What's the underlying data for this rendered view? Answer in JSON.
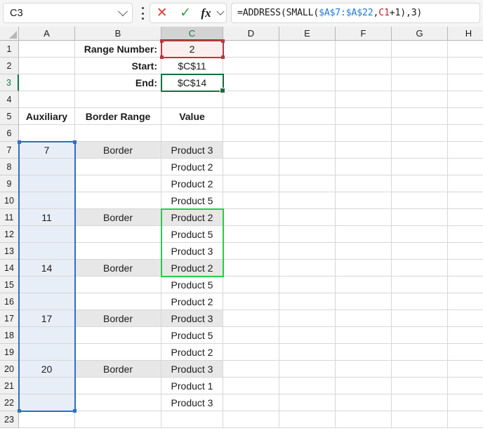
{
  "formula_bar": {
    "name_box_value": "C3",
    "name_box_chevron_icon": "chevron-down-icon",
    "options_icon": "kebab-menu-icon",
    "cancel_icon": "cancel-x-icon",
    "cancel_glyph": "✕",
    "enter_icon": "confirm-check-icon",
    "enter_glyph": "✓",
    "fx_label": "fx",
    "fx_chevron_icon": "chevron-down-icon",
    "formula_parts": [
      {
        "text": "=ADDRESS(SMALL(",
        "color": "black"
      },
      {
        "text": "$A$7:$A$22",
        "color": "blue"
      },
      {
        "text": ",",
        "color": "black"
      },
      {
        "text": "C1",
        "color": "red"
      },
      {
        "text": "+1),3)",
        "color": "black"
      }
    ],
    "formula_full": "=ADDRESS(SMALL($A$7:$A$22,C1+1),3)"
  },
  "grid": {
    "select_all_icon": "select-all-triangle-icon",
    "column_headers": [
      "A",
      "B",
      "C",
      "D",
      "E",
      "F",
      "G",
      "H"
    ],
    "active_column": "C",
    "row_headers": [
      "1",
      "2",
      "3",
      "4",
      "5",
      "6",
      "7",
      "8",
      "9",
      "10",
      "11",
      "12",
      "13",
      "14",
      "15",
      "16",
      "17",
      "18",
      "19",
      "20",
      "21",
      "22",
      "23"
    ],
    "active_row": "3",
    "cells": {
      "B1": "Range Number:",
      "C1": "2",
      "B2": "Start:",
      "C2": "$C$11",
      "B3": "End:",
      "C3": "$C$14",
      "A5": "Auxiliary",
      "B5": "Border Range",
      "C5": "Value"
    },
    "table": {
      "headers": [
        "Auxiliary",
        "Border Range",
        "Value"
      ],
      "rows": [
        {
          "row": "7",
          "auxiliary": "7",
          "border_range": "Border",
          "value": "Product 3"
        },
        {
          "row": "8",
          "auxiliary": "",
          "border_range": "",
          "value": "Product 2"
        },
        {
          "row": "9",
          "auxiliary": "",
          "border_range": "",
          "value": "Product 2"
        },
        {
          "row": "10",
          "auxiliary": "",
          "border_range": "",
          "value": "Product 5"
        },
        {
          "row": "11",
          "auxiliary": "11",
          "border_range": "Border",
          "value": "Product 2"
        },
        {
          "row": "12",
          "auxiliary": "",
          "border_range": "",
          "value": "Product 5"
        },
        {
          "row": "13",
          "auxiliary": "",
          "border_range": "",
          "value": "Product 3"
        },
        {
          "row": "14",
          "auxiliary": "14",
          "border_range": "Border",
          "value": "Product 2"
        },
        {
          "row": "15",
          "auxiliary": "",
          "border_range": "",
          "value": "Product 5"
        },
        {
          "row": "16",
          "auxiliary": "",
          "border_range": "",
          "value": "Product 2"
        },
        {
          "row": "17",
          "auxiliary": "17",
          "border_range": "Border",
          "value": "Product 3"
        },
        {
          "row": "18",
          "auxiliary": "",
          "border_range": "",
          "value": "Product 5"
        },
        {
          "row": "19",
          "auxiliary": "",
          "border_range": "",
          "value": "Product 2"
        },
        {
          "row": "20",
          "auxiliary": "20",
          "border_range": "Border",
          "value": "Product 3"
        },
        {
          "row": "21",
          "auxiliary": "",
          "border_range": "",
          "value": "Product 1"
        },
        {
          "row": "22",
          "auxiliary": "",
          "border_range": "",
          "value": "Product 3"
        }
      ]
    },
    "selections": {
      "precedent_range_blue": "A7:A22",
      "precedent_cell_red": "C1",
      "dependent_range_green": "C11:C14",
      "active_cell": "C3"
    }
  },
  "colors": {
    "active_green": "#107040",
    "precedent_blue": "#2f6fc0",
    "precedent_red": "#b6393f",
    "dependent_green": "#2aca49",
    "border_row_fill": "#e7e7e7",
    "aux_range_fill": "#e8eef8",
    "input_cell_fill": "#fbeeee",
    "formula_token_blue": "#1f7ad4",
    "formula_token_red": "#c0232c"
  }
}
